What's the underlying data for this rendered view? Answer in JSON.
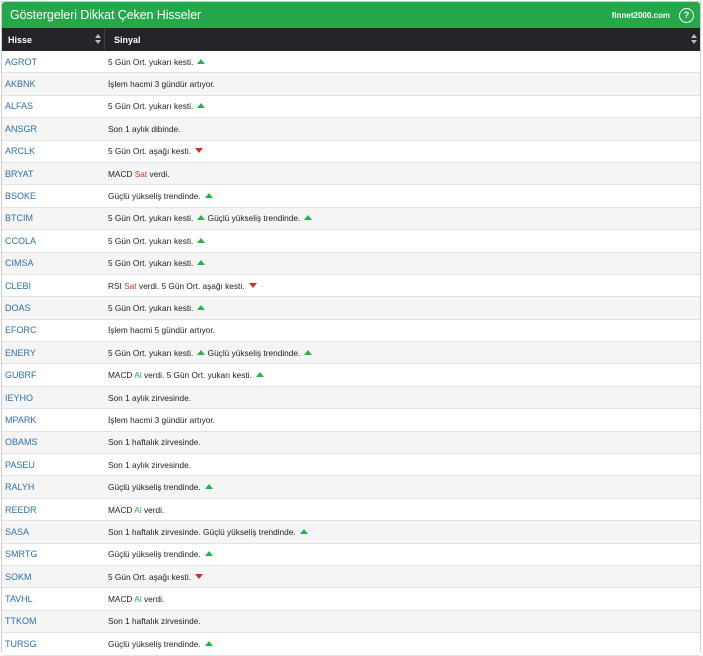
{
  "header": {
    "title": "Göstergeleri Dikkat Çeken Hisseler",
    "brand": "finnet2000.com",
    "help_icon": "?"
  },
  "table": {
    "columns": [
      "Hisse",
      "Sinyal"
    ],
    "rows": [
      {
        "hisse": "AGROT",
        "parts": [
          {
            "t": "5 Gün Ort. yukarı kesti."
          },
          {
            "icon": "up"
          }
        ]
      },
      {
        "hisse": "AKBNK",
        "parts": [
          {
            "t": "İşlem hacmi 3 gündür artıyor."
          }
        ]
      },
      {
        "hisse": "ALFAS",
        "parts": [
          {
            "t": "5 Gün Ort. yukarı kesti."
          },
          {
            "icon": "up"
          }
        ]
      },
      {
        "hisse": "ANSGR",
        "parts": [
          {
            "t": "Son 1 aylık dibinde."
          }
        ]
      },
      {
        "hisse": "ARCLK",
        "parts": [
          {
            "t": "5 Gün Ort. aşağı kesti."
          },
          {
            "icon": "down"
          }
        ]
      },
      {
        "hisse": "BRYAT",
        "parts": [
          {
            "t": "MACD "
          },
          {
            "t": "Sat",
            "c": "sat"
          },
          {
            "t": " verdi."
          }
        ]
      },
      {
        "hisse": "BSOKE",
        "parts": [
          {
            "t": "Güçlü yükseliş trendinde."
          },
          {
            "icon": "up"
          }
        ]
      },
      {
        "hisse": "BTCIM",
        "parts": [
          {
            "t": "5 Gün Ort. yukarı kesti."
          },
          {
            "icon": "up"
          },
          {
            "t": " Güçlü yükseliş trendinde."
          },
          {
            "icon": "up"
          }
        ]
      },
      {
        "hisse": "CCOLA",
        "parts": [
          {
            "t": "5 Gün Ort. yukarı kesti."
          },
          {
            "icon": "up"
          }
        ]
      },
      {
        "hisse": "CIMSA",
        "parts": [
          {
            "t": "5 Gün Ort. yukarı kesti."
          },
          {
            "icon": "up"
          }
        ]
      },
      {
        "hisse": "CLEBI",
        "parts": [
          {
            "t": "RSI "
          },
          {
            "t": "Sat",
            "c": "sat"
          },
          {
            "t": " verdi. 5 Gün Ort. aşağı kesti."
          },
          {
            "icon": "down"
          }
        ]
      },
      {
        "hisse": "DOAS",
        "parts": [
          {
            "t": "5 Gün Ort. yukarı kesti."
          },
          {
            "icon": "up"
          }
        ]
      },
      {
        "hisse": "EFORC",
        "parts": [
          {
            "t": "İşlem hacmi 5 gündür artıyor."
          }
        ]
      },
      {
        "hisse": "ENERY",
        "parts": [
          {
            "t": "5 Gün Ort. yukarı kesti."
          },
          {
            "icon": "up"
          },
          {
            "t": " Güçlü yükseliş trendinde."
          },
          {
            "icon": "up"
          }
        ]
      },
      {
        "hisse": "GUBRF",
        "parts": [
          {
            "t": "MACD "
          },
          {
            "t": "Al",
            "c": "al"
          },
          {
            "t": " verdi. 5 Gün Ort. yukarı kesti."
          },
          {
            "icon": "up"
          }
        ]
      },
      {
        "hisse": "IEYHO",
        "parts": [
          {
            "t": "Son 1 aylık zirvesinde."
          }
        ]
      },
      {
        "hisse": "MPARK",
        "parts": [
          {
            "t": "İşlem hacmi 3 gündür artıyor."
          }
        ]
      },
      {
        "hisse": "OBAMS",
        "parts": [
          {
            "t": "Son 1 haftalık zirvesinde."
          }
        ]
      },
      {
        "hisse": "PASEU",
        "parts": [
          {
            "t": "Son 1 aylık zirvesinde."
          }
        ]
      },
      {
        "hisse": "RALYH",
        "parts": [
          {
            "t": "Güçlü yükseliş trendinde."
          },
          {
            "icon": "up"
          }
        ]
      },
      {
        "hisse": "REEDR",
        "parts": [
          {
            "t": "MACD "
          },
          {
            "t": "Al",
            "c": "al"
          },
          {
            "t": " verdi."
          }
        ]
      },
      {
        "hisse": "SASA",
        "parts": [
          {
            "t": "Son 1 haftalık zirvesinde. Güçlü yükseliş trendinde."
          },
          {
            "icon": "up"
          }
        ]
      },
      {
        "hisse": "SMRTG",
        "parts": [
          {
            "t": "Güçlü yükseliş trendinde."
          },
          {
            "icon": "up"
          }
        ]
      },
      {
        "hisse": "SOKM",
        "parts": [
          {
            "t": "5 Gün Ort. aşağı kesti."
          },
          {
            "icon": "down"
          }
        ]
      },
      {
        "hisse": "TAVHL",
        "parts": [
          {
            "t": "MACD "
          },
          {
            "t": "Al",
            "c": "al"
          },
          {
            "t": " verdi."
          }
        ]
      },
      {
        "hisse": "TTKOM",
        "parts": [
          {
            "t": "Son 1 haftalık zirvesinde."
          }
        ]
      },
      {
        "hisse": "TURSG",
        "parts": [
          {
            "t": "Güçlü yükseliş trendinde."
          },
          {
            "icon": "up"
          }
        ]
      }
    ]
  },
  "colors": {
    "header_green": "#24a84a",
    "table_head": "#222428",
    "ticker_link": "#2e6fab",
    "up_arrow": "#27b34b",
    "down_arrow": "#c0392b"
  }
}
